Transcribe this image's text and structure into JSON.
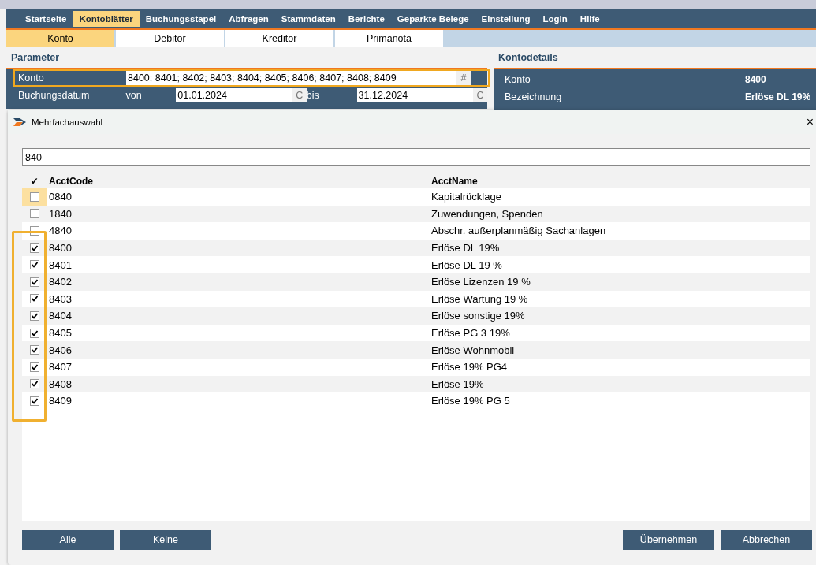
{
  "menu": [
    {
      "label": "Startseite",
      "selected": false
    },
    {
      "label": "Kontoblätter",
      "selected": true
    },
    {
      "label": "Buchungsstapel",
      "selected": false
    },
    {
      "label": "Abfragen",
      "selected": false
    },
    {
      "label": "Stammdaten",
      "selected": false
    },
    {
      "label": "Berichte",
      "selected": false
    },
    {
      "label": "Geparkte Belege",
      "selected": false
    },
    {
      "label": "Einstellung",
      "selected": false
    },
    {
      "label": "Login",
      "selected": false
    },
    {
      "label": "Hilfe",
      "selected": false
    }
  ],
  "tabs": [
    {
      "label": "Konto",
      "selected": true
    },
    {
      "label": "Debitor",
      "selected": false
    },
    {
      "label": "Kreditor",
      "selected": false
    },
    {
      "label": "Primanota",
      "selected": false
    }
  ],
  "parameter": {
    "title": "Parameter",
    "konto_label": "Konto",
    "konto_value": "8400; 8401; 8402; 8403; 8404; 8405; 8406; 8407; 8408; 8409",
    "konto_button": "#",
    "date_label": "Buchungsdatum",
    "from_label": "von",
    "from_value": "01.01.2024",
    "from_button": "C",
    "to_label": "bis",
    "to_value": "31.12.2024",
    "to_button": "C"
  },
  "details": {
    "title": "Kontodetails",
    "rows": [
      {
        "label": "Konto",
        "value": "8400"
      },
      {
        "label": "Bezeichnung",
        "value": "Erlöse DL 19%"
      }
    ]
  },
  "dialog": {
    "title": "Mehrfachauswahl",
    "close": "×",
    "search_value": "840",
    "columns": [
      "✓",
      "AcctCode",
      "AcctName"
    ],
    "rows": [
      {
        "code": "0840",
        "name": "Kapitalrücklage",
        "checked": false,
        "selected": true
      },
      {
        "code": "1840",
        "name": "Zuwendungen, Spenden",
        "checked": false,
        "selected": false
      },
      {
        "code": "4840",
        "name": "Abschr. außerplanmäßig Sachanlagen",
        "checked": false,
        "selected": false
      },
      {
        "code": "8400",
        "name": "Erlöse DL 19%",
        "checked": true,
        "selected": false
      },
      {
        "code": "8401",
        "name": "Erlöse DL 19 %",
        "checked": true,
        "selected": false
      },
      {
        "code": "8402",
        "name": "Erlöse Lizenzen 19 %",
        "checked": true,
        "selected": false
      },
      {
        "code": "8403",
        "name": "Erlöse Wartung 19 %",
        "checked": true,
        "selected": false
      },
      {
        "code": "8404",
        "name": "Erlöse sonstige 19%",
        "checked": true,
        "selected": false
      },
      {
        "code": "8405",
        "name": "Erlöse PG 3 19%",
        "checked": true,
        "selected": false
      },
      {
        "code": "8406",
        "name": "Erlöse Wohnmobil",
        "checked": true,
        "selected": false
      },
      {
        "code": "8407",
        "name": "Erlöse 19% PG4",
        "checked": true,
        "selected": false
      },
      {
        "code": "8408",
        "name": "Erlöse 19%",
        "checked": true,
        "selected": false
      },
      {
        "code": "8409",
        "name": "Erlöse 19% PG 5",
        "checked": true,
        "selected": false
      }
    ],
    "buttons_left": [
      "Alle",
      "Keine"
    ],
    "buttons_right": [
      "Übernehmen",
      "Abbrechen"
    ]
  }
}
